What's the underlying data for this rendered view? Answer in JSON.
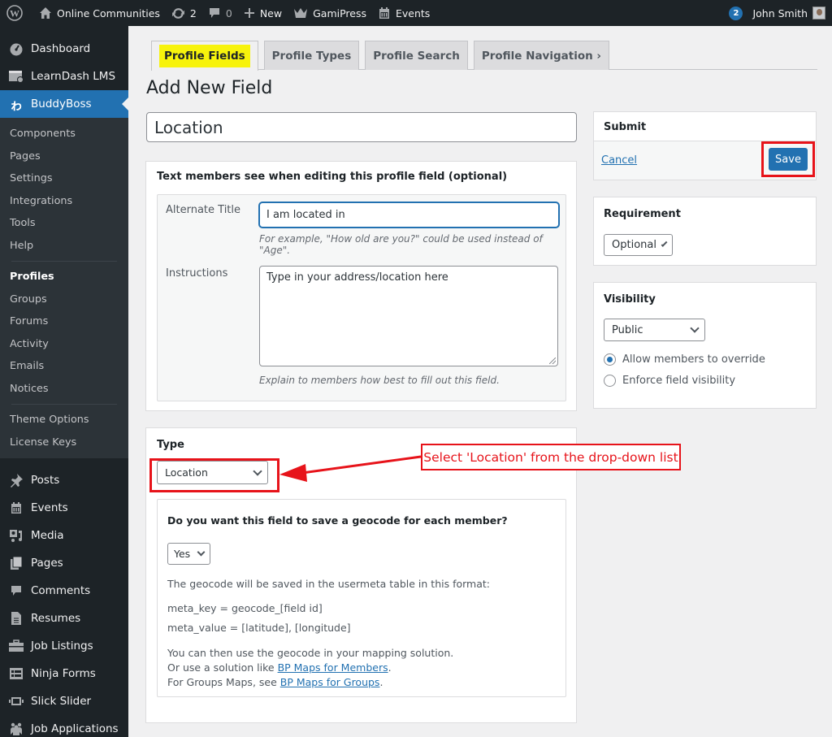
{
  "admin_bar": {
    "site_name": "Online Communities",
    "updates_count": "2",
    "comments_count": "0",
    "new_label": "New",
    "gamipress_label": "GamiPress",
    "events_label": "Events",
    "notifications_count": "2",
    "user_name": "John Smith"
  },
  "sidebar": {
    "top_items": [
      {
        "label": "Dashboard",
        "icon": "dashboard-icon"
      },
      {
        "label": "LearnDash LMS",
        "icon": "learndash-icon"
      },
      {
        "label": "BuddyBoss",
        "icon": "buddyboss-icon",
        "active": true
      }
    ],
    "submenu_group1": [
      "Components",
      "Pages",
      "Settings",
      "Integrations",
      "Tools",
      "Help"
    ],
    "submenu_group2": [
      "Profiles",
      "Groups",
      "Forums",
      "Activity",
      "Emails",
      "Notices"
    ],
    "submenu_current": "Profiles",
    "submenu_group3": [
      "Theme Options",
      "License Keys"
    ],
    "bottom_items": [
      {
        "label": "Posts",
        "icon": "pin-icon"
      },
      {
        "label": "Events",
        "icon": "calendar-icon"
      },
      {
        "label": "Media",
        "icon": "media-icon"
      },
      {
        "label": "Pages",
        "icon": "pages-icon"
      },
      {
        "label": "Comments",
        "icon": "comment-icon"
      },
      {
        "label": "Resumes",
        "icon": "document-icon"
      },
      {
        "label": "Job Listings",
        "icon": "briefcase-icon"
      },
      {
        "label": "Ninja Forms",
        "icon": "form-icon"
      },
      {
        "label": "Slick Slider",
        "icon": "slider-icon"
      },
      {
        "label": "Job Applications",
        "icon": "people-icon"
      }
    ]
  },
  "tabs": [
    {
      "label": "Profile Fields",
      "active": true
    },
    {
      "label": "Profile Types"
    },
    {
      "label": "Profile Search"
    },
    {
      "label": "Profile Navigation ›"
    }
  ],
  "page_title": "Add New Field",
  "field_name_value": "Location",
  "member_text": {
    "heading": "Text members see when editing this profile field (optional)",
    "alt_title_label": "Alternate Title",
    "alt_title_value": "I am located in",
    "alt_title_desc": "For example, \"How old are you?\" could be used instead of \"Age\".",
    "instructions_label": "Instructions",
    "instructions_value": "Type in your address/location here",
    "instructions_desc": "Explain to members how best to fill out this field."
  },
  "type_box": {
    "heading": "Type",
    "selected": "Location",
    "annotation": "Select 'Location' from the drop-down list",
    "geocode_question": "Do you want this field to save a geocode for each member?",
    "geocode_selected": "Yes",
    "format_text": "The geocode will be saved in the usermeta table in this format:",
    "meta_key": "meta_key = geocode_[field id]",
    "meta_value": "meta_value = [latitude], [longitude]",
    "line1": "You can then use the geocode in your mapping solution.",
    "line2_prefix": "Or use a solution like ",
    "line2_link": "BP Maps for Members",
    "line3_prefix": "For Groups Maps, see ",
    "line3_link": "BP Maps for Groups",
    "period": "."
  },
  "submit_box": {
    "heading": "Submit",
    "cancel": "Cancel",
    "save": "Save"
  },
  "requirement_box": {
    "heading": "Requirement",
    "selected": "Optional"
  },
  "visibility_box": {
    "heading": "Visibility",
    "selected": "Public",
    "options": [
      {
        "label": "Allow members to override",
        "checked": true
      },
      {
        "label": "Enforce field visibility",
        "checked": false
      }
    ]
  },
  "colors": {
    "accent": "#2271b1",
    "annotation_red": "#e7131a",
    "tab_highlight": "#f7f30c"
  }
}
